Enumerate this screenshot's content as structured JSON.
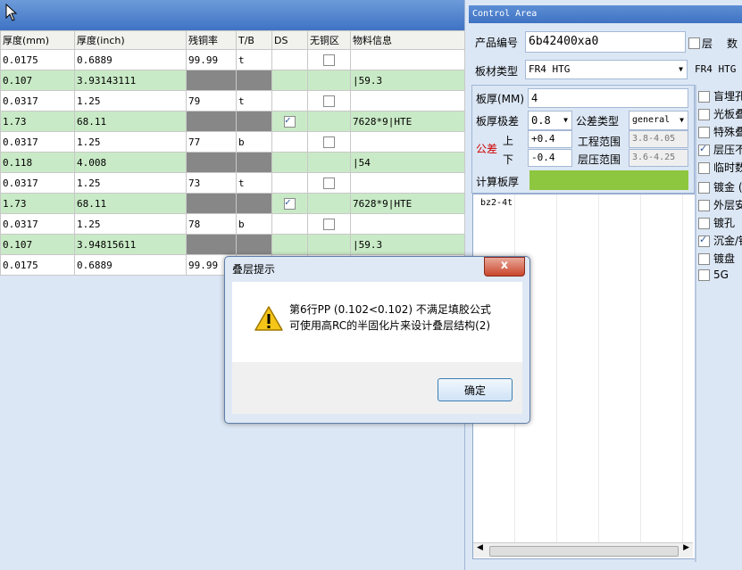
{
  "grid": {
    "headers": [
      "厚度(mm)",
      "厚度(inch)",
      "残铜率",
      "T/B",
      "DS",
      "无铜区",
      "物料信息"
    ],
    "rows": [
      {
        "mm": "0.0175",
        "inch": "0.6889",
        "cu": "99.99",
        "tb": "t",
        "ds": null,
        "nocu": false,
        "material": ""
      },
      {
        "mm": "0.107",
        "inch": "3.93143111",
        "cu": null,
        "tb": null,
        "ds": null,
        "nocu": null,
        "material": "|59.3"
      },
      {
        "mm": "0.0317",
        "inch": "1.25",
        "cu": "79",
        "tb": "t",
        "ds": null,
        "nocu": false,
        "material": ""
      },
      {
        "mm": "1.73",
        "inch": "68.11",
        "cu": null,
        "tb": null,
        "ds": true,
        "nocu": null,
        "material": "7628*9|HTE"
      },
      {
        "mm": "0.0317",
        "inch": "1.25",
        "cu": "77",
        "tb": "b",
        "ds": null,
        "nocu": false,
        "material": ""
      },
      {
        "mm": "0.118",
        "inch": "4.008",
        "cu": null,
        "tb": null,
        "ds": null,
        "nocu": null,
        "material": "|54"
      },
      {
        "mm": "0.0317",
        "inch": "1.25",
        "cu": "73",
        "tb": "t",
        "ds": null,
        "nocu": false,
        "material": ""
      },
      {
        "mm": "1.73",
        "inch": "68.11",
        "cu": null,
        "tb": null,
        "ds": true,
        "nocu": null,
        "material": "7628*9|HTE"
      },
      {
        "mm": "0.0317",
        "inch": "1.25",
        "cu": "78",
        "tb": "b",
        "ds": null,
        "nocu": false,
        "material": ""
      },
      {
        "mm": "0.107",
        "inch": "3.94815611",
        "cu": null,
        "tb": null,
        "ds": null,
        "nocu": null,
        "material": "|59.3"
      },
      {
        "mm": "0.0175",
        "inch": "0.6889",
        "cu": "99.99",
        "tb": "",
        "ds": null,
        "nocu": null,
        "material": ""
      }
    ]
  },
  "control": {
    "title": "Control Area",
    "product_label": "产品编号",
    "product_value": "6b42400xa0",
    "layer_label": "层",
    "layer_count_label": "数",
    "board_type_label": "板材类型",
    "board_type_value": "FR4 HTG",
    "board_type_value2": "FR4 HTG",
    "thickness_label": "板厚(MM)",
    "thickness_value": "4",
    "thickness_tol_label": "板厚极差",
    "thickness_tol_value": "0.8",
    "tol_type_label": "公差类型",
    "tol_type_value": "general",
    "tolerance_label": "公差",
    "upper_label": "上",
    "lower_label": "下",
    "upper_value": "+0.4",
    "lower_value": "-0.4",
    "eng_range_label": "工程范围",
    "eng_range_value": "3.8-4.05",
    "press_range_label": "层压范围",
    "press_range_value": "3.6-4.25",
    "calc_label": "计算板厚",
    "list_first": "bz2-4t"
  },
  "side_options": [
    {
      "label": "盲埋孔",
      "checked": false
    },
    {
      "label": "光板叠",
      "checked": false
    },
    {
      "label": "特殊叠",
      "checked": false
    },
    {
      "label": "层压不",
      "checked": true
    },
    {
      "label": "临时数",
      "checked": false
    },
    {
      "label": "镀金 (",
      "checked": false
    },
    {
      "label": "外层安",
      "checked": false
    },
    {
      "label": "镀孔",
      "checked": false
    },
    {
      "label": "沉金/银",
      "checked": true
    },
    {
      "label": "镀盘",
      "checked": false
    },
    {
      "label": "5G",
      "checked": false
    }
  ],
  "dialog": {
    "title": "叠层提示",
    "close": "x",
    "message_line1": "第6行PP (0.102<0.102) 不满足填胶公式",
    "message_line2": "可使用高RC的半固化片来设计叠层结构(2)",
    "ok_label": "确定"
  },
  "colors": {
    "row_green": "#c9eac6",
    "gray_cell": "#878787",
    "calc_bar": "#8dc63f",
    "title_blue": "#3f72c2"
  }
}
